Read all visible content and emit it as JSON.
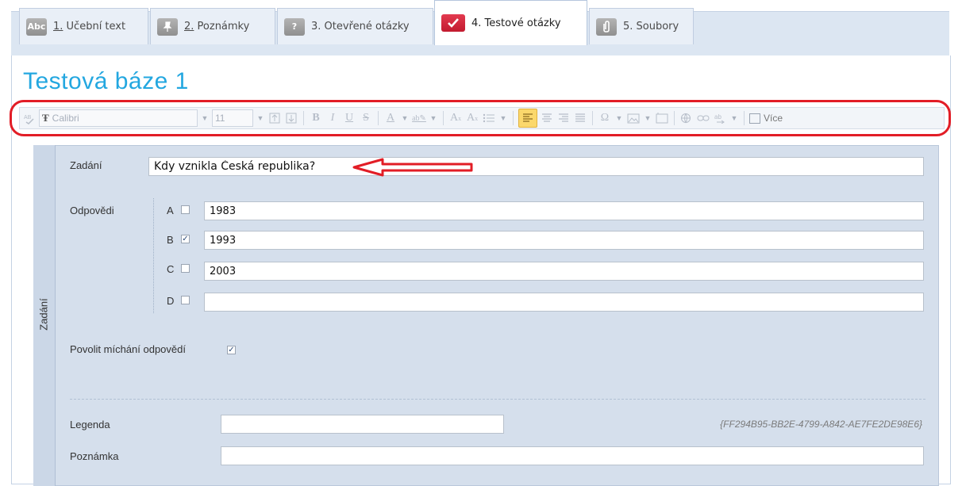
{
  "tabs": [
    {
      "icon": "abc-icon",
      "icon_text": "Abc",
      "num": "1.",
      "label": " Učební text",
      "active": false
    },
    {
      "icon": "pin-icon",
      "icon_text": "",
      "num": "2.",
      "label": " Poznámky",
      "active": false
    },
    {
      "icon": "question-icon",
      "icon_text": "?",
      "num": "",
      "label": "3. Otevřené otázky",
      "active": false
    },
    {
      "icon": "check-icon",
      "icon_text": "",
      "num": "",
      "label": "4. Testové otázky",
      "active": true
    },
    {
      "icon": "paperclip-icon",
      "icon_text": "",
      "num": "",
      "label": "5. Soubory",
      "active": false
    }
  ],
  "page": {
    "title": "Testová báze 1"
  },
  "toolbar": {
    "font": "Calibri",
    "size": "11",
    "more_label": "Více",
    "accent": "#fbd86c"
  },
  "form": {
    "side_label": "Zadání",
    "question_label": "Zadání",
    "question_value": "Kdy vznikla Česká republika?",
    "answers_label": "Odpovědi",
    "answers": [
      {
        "letter": "A",
        "checked": false,
        "value": "1983"
      },
      {
        "letter": "B",
        "checked": true,
        "value": "1993"
      },
      {
        "letter": "C",
        "checked": false,
        "value": "2003"
      },
      {
        "letter": "D",
        "checked": false,
        "value": ""
      }
    ],
    "shuffle_label": "Povolit míchání odpovědí",
    "shuffle_checked": true,
    "legend_label": "Legenda",
    "legend_value": "",
    "guid": "{FF294B95-BB2E-4799-A842-AE7FE2DE98E6}",
    "note_label": "Poznámka",
    "note_value": ""
  },
  "colors": {
    "title": "#23a7e0",
    "highlight": "#e21d26",
    "panel": "#d5dfec"
  }
}
